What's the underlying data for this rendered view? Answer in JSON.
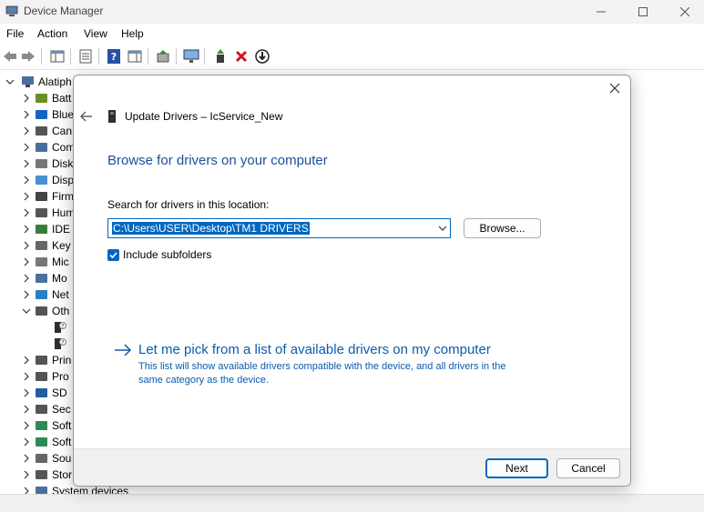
{
  "window": {
    "title": "Device Manager"
  },
  "menu": [
    "File",
    "Action",
    "View",
    "Help"
  ],
  "tree": {
    "root_label": "Alatiph",
    "items": [
      {
        "label": "Batt",
        "expanded": false
      },
      {
        "label": "Blue",
        "expanded": false
      },
      {
        "label": "Can",
        "expanded": false
      },
      {
        "label": "Com",
        "expanded": false
      },
      {
        "label": "Disk",
        "expanded": false
      },
      {
        "label": "Disp",
        "expanded": false
      },
      {
        "label": "Firm",
        "expanded": false
      },
      {
        "label": "Hum",
        "expanded": false
      },
      {
        "label": "IDE",
        "expanded": false
      },
      {
        "label": "Key",
        "expanded": false
      },
      {
        "label": "Mic",
        "expanded": false
      },
      {
        "label": "Mo",
        "expanded": false
      },
      {
        "label": "Net",
        "expanded": false
      },
      {
        "label": "Oth",
        "expanded": true
      },
      {
        "label": "",
        "child": true
      },
      {
        "label": "",
        "child": true
      },
      {
        "label": "Prin",
        "expanded": false
      },
      {
        "label": "Pro",
        "expanded": false
      },
      {
        "label": "SD",
        "expanded": false
      },
      {
        "label": "Sec",
        "expanded": false
      },
      {
        "label": "Soft",
        "expanded": false
      },
      {
        "label": "Soft",
        "expanded": false
      },
      {
        "label": "Sou",
        "expanded": false
      },
      {
        "label": "Stor",
        "expanded": false
      },
      {
        "label": "System devices",
        "expanded": false
      }
    ]
  },
  "dialog": {
    "title": "Update Drivers – IcService_New",
    "heading": "Browse for drivers on your computer",
    "search_label": "Search for drivers in this location:",
    "path_value": "C:\\Users\\USER\\Desktop\\TM1 DRIVERS",
    "browse_label": "Browse...",
    "include_subfolders_label": "Include subfolders",
    "include_subfolders_checked": true,
    "pick_link": "Let me pick from a list of available drivers on my computer",
    "pick_desc_line1": "This list will show available drivers compatible with the device, and all drivers in the",
    "pick_desc_line2": "same category as the device.",
    "next_label": "Next",
    "cancel_label": "Cancel"
  },
  "colors": {
    "accent": "#0067c0",
    "heading": "#1f4e9a",
    "link": "#0b5cad"
  }
}
